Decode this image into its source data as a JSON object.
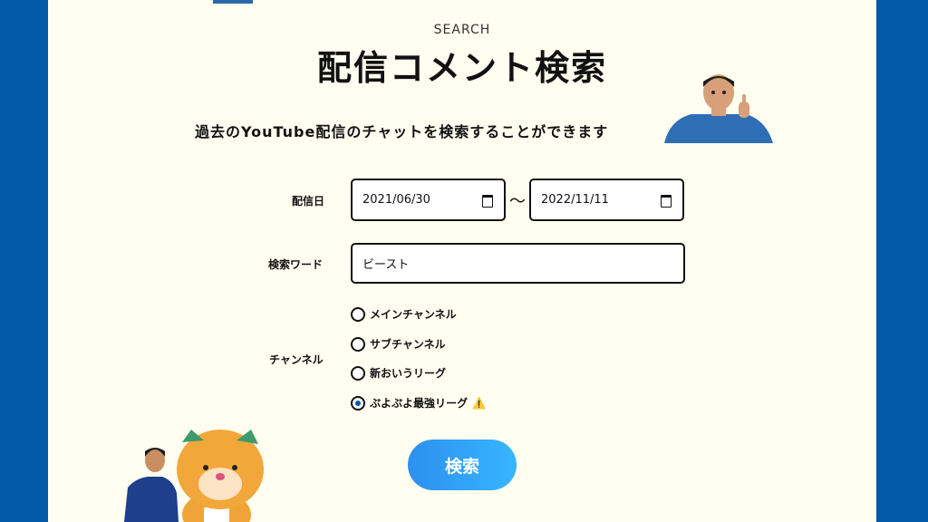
{
  "header": {
    "eyebrow": "SEARCH",
    "title": "配信コメント検索",
    "subtitle": "過去のYouTube配信のチャットを検索することができます"
  },
  "form": {
    "date_label": "配信日",
    "date_from": "2021/06/30",
    "date_separator": "～",
    "date_to": "2022/11/11",
    "keyword_label": "検索ワード",
    "keyword_value": "ビースト",
    "channel_label": "チャンネル",
    "channels": [
      {
        "label": "メインチャンネル",
        "checked": false
      },
      {
        "label": "サブチャンネル",
        "checked": false
      },
      {
        "label": "新おいうリーグ",
        "checked": false
      },
      {
        "label": "ぷよぷよ最強リーグ",
        "checked": true
      }
    ],
    "warning_icon": "⚠️",
    "submit_label": "検索"
  },
  "colors": {
    "background": "#005aa6",
    "panel": "#fffef0",
    "button_start": "#2c8ff0",
    "button_end": "#38b6ff"
  },
  "icons": [
    "calendar-icon",
    "warning-icon"
  ]
}
